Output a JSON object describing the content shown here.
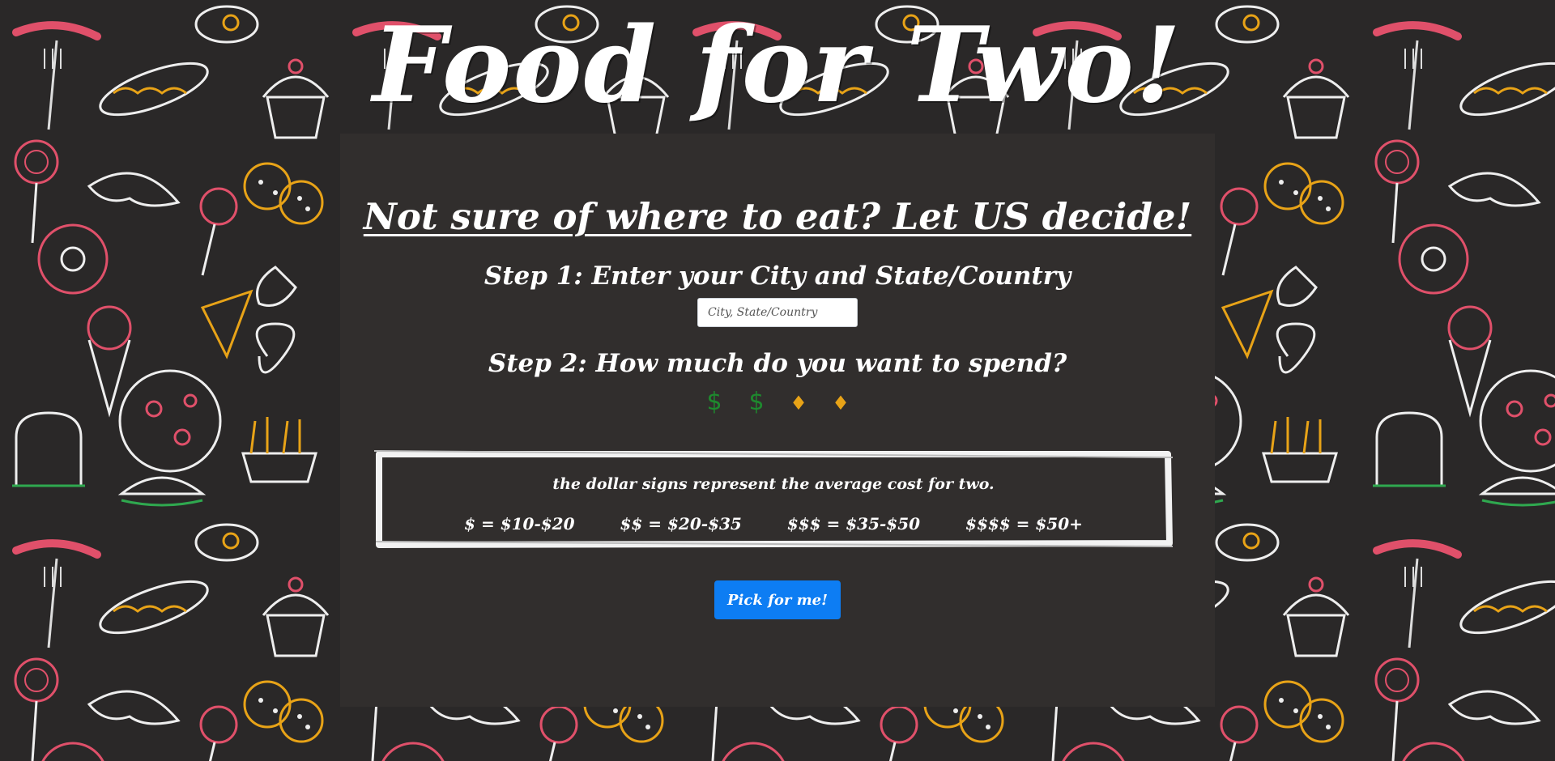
{
  "header": {
    "title": "Food for Two!"
  },
  "main": {
    "tagline": "Not sure of where to eat? Let US decide!",
    "step1": {
      "heading": "Step 1: Enter your City and State/Country",
      "input_value": "",
      "input_placeholder": "City, State/Country"
    },
    "step2": {
      "heading": "Step 2: How much do you want to spend?",
      "price_options": [
        {
          "symbol": "$",
          "state": "selected",
          "icon": "dollar-icon",
          "color": "#1e8a2e"
        },
        {
          "symbol": "$",
          "state": "selected",
          "icon": "dollar-icon",
          "color": "#1e8a2e"
        },
        {
          "symbol": "♦",
          "state": "unselected",
          "icon": "diamond-icon",
          "color": "#e8a317"
        },
        {
          "symbol": "♦",
          "state": "unselected",
          "icon": "diamond-icon",
          "color": "#e8a317"
        }
      ]
    },
    "legend": {
      "note": "the dollar signs represent the average cost for two.",
      "items": [
        "$ = $10-$20",
        "$$ = $20-$35",
        "$$$ = $35-$50",
        "$$$$ = $50+"
      ]
    },
    "pick_button_label": "Pick for me!"
  },
  "colors": {
    "background": "#2a2828",
    "panel": "#312e2d",
    "button": "#0d7df3",
    "selected_price": "#1e8a2e",
    "unselected_price": "#e8a317"
  }
}
